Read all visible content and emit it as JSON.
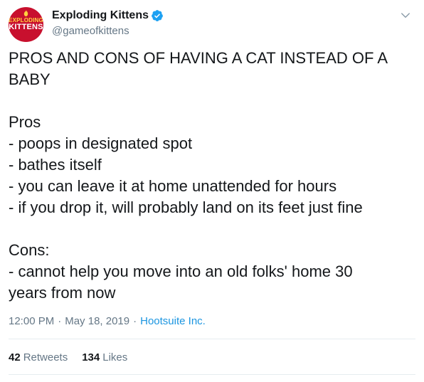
{
  "account": {
    "display_name": "Exploding Kittens",
    "handle": "@gameofkittens",
    "avatar_text_small": "EXPLODING",
    "avatar_text_big": "KITTENS",
    "verified": true
  },
  "tweet": {
    "lines": [
      "PROS AND CONS OF HAVING A CAT INSTEAD OF A",
      "BABY",
      "",
      "Pros",
      "- poops in designated spot",
      "- bathes itself",
      "- you can leave it at home unattended for hours",
      "- if you drop it, will probably land on its feet just fine",
      "",
      "Cons:",
      "- cannot help you move into an old folks' home 30",
      "years from now"
    ],
    "time": "12:00 PM",
    "date": "May 18, 2019",
    "source": "Hootsuite Inc."
  },
  "stats": {
    "retweets_count": "42",
    "retweets_label": "Retweets",
    "likes_count": "134",
    "likes_label": "Likes"
  },
  "colors": {
    "link": "#1b95e0",
    "verified": "#1da1f2",
    "secondary_text": "#657786",
    "avatar_bg": "#c8102e"
  },
  "icons": {
    "verified": "verified-badge-icon",
    "menu": "chevron-down-icon"
  }
}
